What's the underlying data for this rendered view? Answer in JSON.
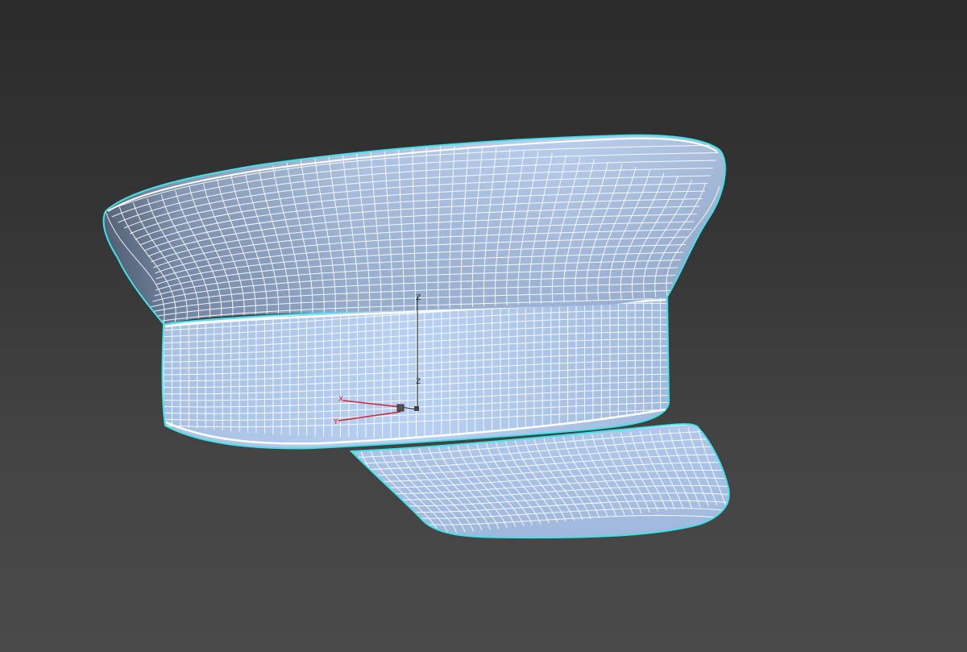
{
  "viewport": {
    "background_top": "#2b2b2b",
    "background_bottom": "#4a4a4a"
  },
  "model": {
    "name": "",
    "shade_color": "#a9c4ea",
    "shade_dark": "#5d6f88",
    "wire_color": "#ffffff",
    "selection_outline": "#3fe3e8"
  },
  "gizmo": {
    "x_label": "X",
    "y_label": "Y",
    "z_label": "Z",
    "z_label_secondary": "Z",
    "axis_color_x": "#d0233a",
    "axis_color_y": "#d0233a",
    "axis_color_z": "#2a2a2a"
  }
}
